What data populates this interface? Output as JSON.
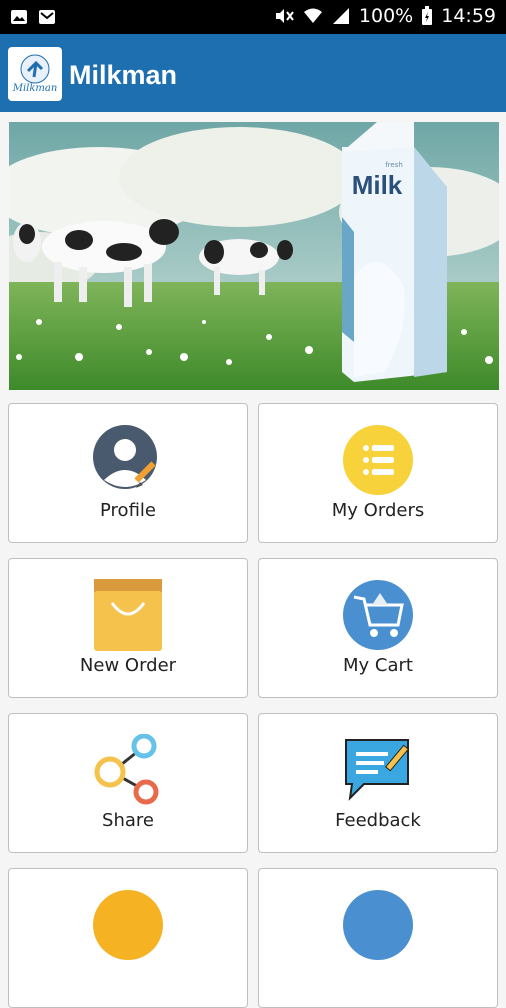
{
  "status_bar": {
    "battery": "100%",
    "time": "14:59"
  },
  "app": {
    "title": "Milkman",
    "logo_text": "Milkman"
  },
  "banner": {
    "carton_text": "Milk",
    "carton_small_text": "fresh"
  },
  "menu": [
    {
      "label": "Profile",
      "icon": "profile-icon"
    },
    {
      "label": "My Orders",
      "icon": "list-icon"
    },
    {
      "label": "New Order",
      "icon": "shopping-bag-icon"
    },
    {
      "label": "My Cart",
      "icon": "cart-icon"
    },
    {
      "label": "Share",
      "icon": "share-icon"
    },
    {
      "label": "Feedback",
      "icon": "feedback-icon"
    },
    {
      "label": "",
      "icon": "yellow-circle-icon"
    },
    {
      "label": "",
      "icon": "blue-circle-icon"
    }
  ],
  "colors": {
    "appbar": "#1e6fb0",
    "statusbar": "#000000"
  }
}
